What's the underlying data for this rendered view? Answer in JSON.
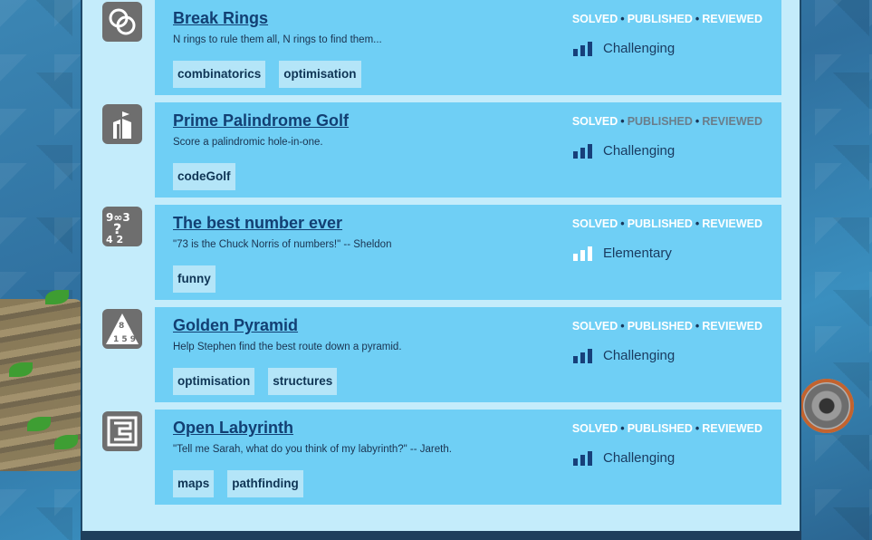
{
  "colors": {
    "bar_filled": "#17407a",
    "bar_empty": "#ffffff",
    "status_done": "#ffffff",
    "status_pending": "#6a7d8a"
  },
  "puzzles": [
    {
      "icon": "rings-icon",
      "title": "Break Rings",
      "description": "N rings to rule them all, N rings to find them...",
      "tags": [
        "combinatorics",
        "optimisation"
      ],
      "status": [
        "SOLVED",
        "PUBLISHED",
        "REVIEWED"
      ],
      "status_done": [
        true,
        true,
        true
      ],
      "difficulty": "Challenging",
      "difficulty_level": 3
    },
    {
      "icon": "golf-flag-icon",
      "title": "Prime Palindrome Golf",
      "description": "Score a palindromic hole-in-one.",
      "tags": [
        "codeGolf"
      ],
      "status": [
        "SOLVED",
        "PUBLISHED",
        "REVIEWED"
      ],
      "status_done": [
        true,
        false,
        false
      ],
      "difficulty": "Challenging",
      "difficulty_level": 3
    },
    {
      "icon": "numbers-icon",
      "title": "The best number ever",
      "description": "\"73 is the Chuck Norris of numbers!\" -- Sheldon",
      "tags": [
        "funny"
      ],
      "status": [
        "SOLVED",
        "PUBLISHED",
        "REVIEWED"
      ],
      "status_done": [
        true,
        true,
        true
      ],
      "difficulty": "Elementary",
      "difficulty_level": 0
    },
    {
      "icon": "pyramid-icon",
      "title": "Golden Pyramid",
      "description": "Help Stephen find the best route down a pyramid.",
      "tags": [
        "optimisation",
        "structures"
      ],
      "status": [
        "SOLVED",
        "PUBLISHED",
        "REVIEWED"
      ],
      "status_done": [
        true,
        true,
        true
      ],
      "difficulty": "Challenging",
      "difficulty_level": 3
    },
    {
      "icon": "labyrinth-icon",
      "title": "Open Labyrinth",
      "description": "\"Tell me Sarah, what do you think of my labyrinth?\" -- Jareth.",
      "tags": [
        "maps",
        "pathfinding"
      ],
      "status": [
        "SOLVED",
        "PUBLISHED",
        "REVIEWED"
      ],
      "status_done": [
        true,
        true,
        true
      ],
      "difficulty": "Challenging",
      "difficulty_level": 3
    }
  ]
}
